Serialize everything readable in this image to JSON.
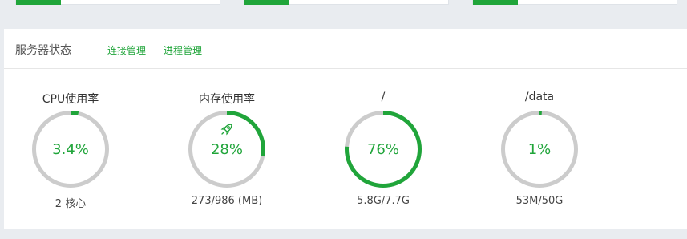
{
  "colors": {
    "accent": "#20a53a",
    "track": "#cccccc"
  },
  "panel": {
    "title": "服务器状态",
    "links": [
      "连接管理",
      "进程管理"
    ]
  },
  "gauges": [
    {
      "title": "CPU使用率",
      "value": "3.4%",
      "percent": 3.4,
      "sub": "2 核心"
    },
    {
      "title": "内存使用率",
      "value": "28%",
      "percent": 28,
      "sub": "273/986 (MB)",
      "icon": "rocket-icon"
    },
    {
      "title": "/",
      "value": "76%",
      "percent": 76,
      "sub": "5.8G/7.7G"
    },
    {
      "title": "/data",
      "value": "1%",
      "percent": 1,
      "sub": "53M/50G"
    }
  ]
}
